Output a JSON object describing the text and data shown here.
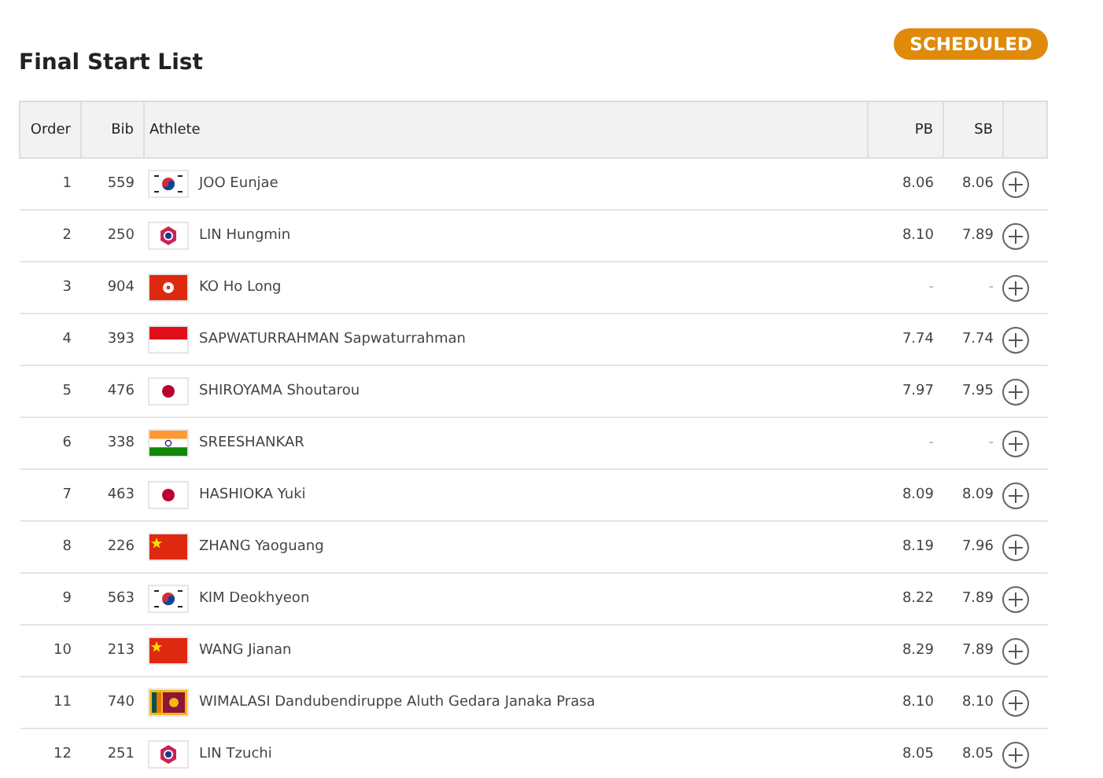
{
  "title": "Final Start List",
  "status_badge": "SCHEDULED",
  "table": {
    "columns": [
      "Order",
      "Bib",
      "Athlete",
      "PB",
      "SB"
    ],
    "rows": [
      {
        "order": "1",
        "bib": "559",
        "kind": "kr",
        "athlete": "JOO Eunjae",
        "pb": "8.06",
        "sb": "8.06"
      },
      {
        "order": "2",
        "bib": "250",
        "kind": "tpe",
        "athlete": "LIN Hungmin",
        "pb": "8.10",
        "sb": "7.89"
      },
      {
        "order": "3",
        "bib": "904",
        "kind": "hk",
        "athlete": "KO Ho Long",
        "pb": "-",
        "sb": "-"
      },
      {
        "order": "4",
        "bib": "393",
        "kind": "id",
        "athlete": "SAPWATURRAHMAN Sapwaturrahman",
        "pb": "7.74",
        "sb": "7.74"
      },
      {
        "order": "5",
        "bib": "476",
        "kind": "jp",
        "athlete": "SHIROYAMA Shoutarou",
        "pb": "7.97",
        "sb": "7.95"
      },
      {
        "order": "6",
        "bib": "338",
        "kind": "in",
        "athlete": "SREESHANKAR",
        "pb": "-",
        "sb": "-"
      },
      {
        "order": "7",
        "bib": "463",
        "kind": "jp",
        "athlete": "HASHIOKA Yuki",
        "pb": "8.09",
        "sb": "8.09"
      },
      {
        "order": "8",
        "bib": "226",
        "kind": "cn",
        "athlete": "ZHANG Yaoguang",
        "pb": "8.19",
        "sb": "7.96"
      },
      {
        "order": "9",
        "bib": "563",
        "kind": "kr",
        "athlete": "KIM Deokhyeon",
        "pb": "8.22",
        "sb": "7.89"
      },
      {
        "order": "10",
        "bib": "213",
        "kind": "cn",
        "athlete": "WANG Jianan",
        "pb": "8.29",
        "sb": "7.89"
      },
      {
        "order": "11",
        "bib": "740",
        "kind": "lk",
        "athlete": "WIMALASI Dandubendiruppe Aluth Gedara Janaka Prasa",
        "pb": "8.10",
        "sb": "8.10"
      },
      {
        "order": "12",
        "bib": "251",
        "kind": "tpe",
        "athlete": "LIN Tzuchi",
        "pb": "8.05",
        "sb": "8.05"
      }
    ]
  }
}
